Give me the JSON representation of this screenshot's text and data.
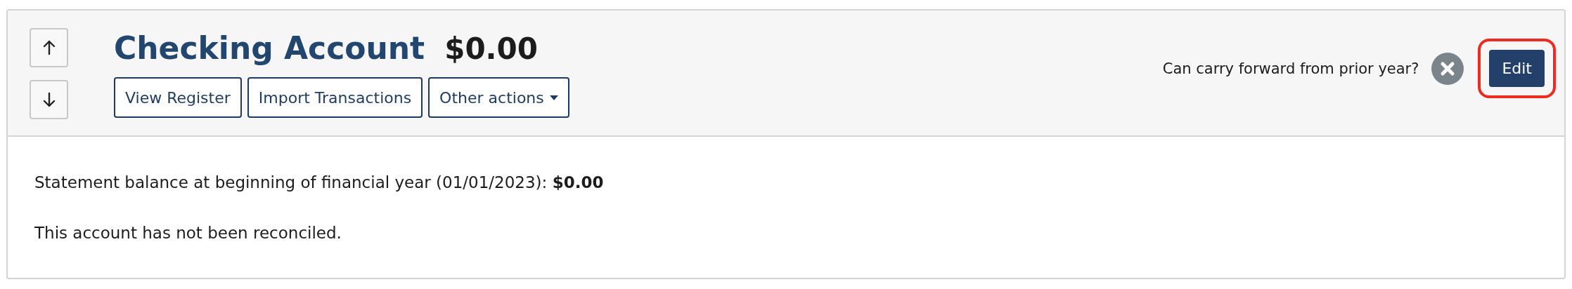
{
  "account": {
    "name": "Checking Account",
    "balance": "$0.00"
  },
  "move_buttons": [
    {
      "kind": "up"
    },
    {
      "kind": "down"
    }
  ],
  "actions": [
    {
      "label": "View Register",
      "kind": "plain"
    },
    {
      "label": "Import Transactions",
      "kind": "plain"
    },
    {
      "label": "Other actions",
      "kind": "dropdown"
    }
  ],
  "carry_forward": {
    "label": "Can carry forward from prior year?",
    "enabled": false
  },
  "edit_button": {
    "label": "Edit",
    "highlighted": true
  },
  "details": [
    {
      "text": "Statement balance at beginning of financial year (01/01/2023): **$0.00**"
    },
    {
      "text": "This account has not been reconciled."
    }
  ]
}
